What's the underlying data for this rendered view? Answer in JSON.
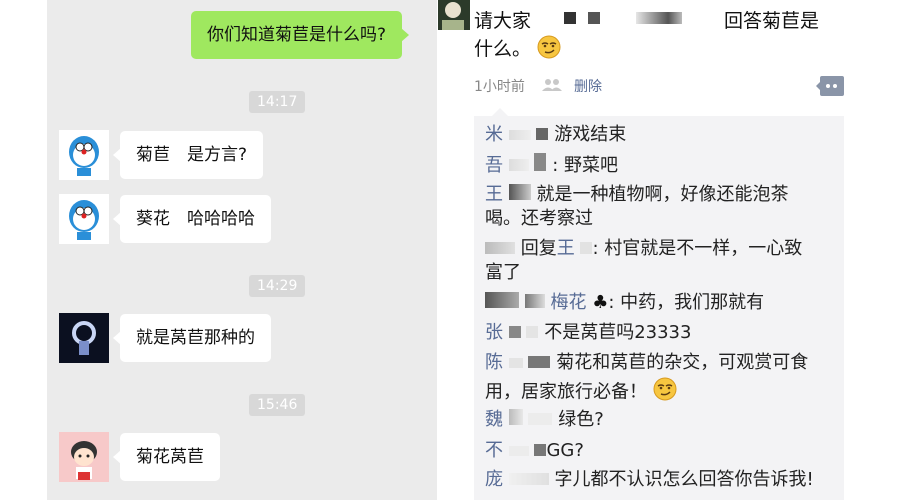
{
  "chat": {
    "messages": [
      {
        "side": "sent",
        "text": "你们知道菊苣是什么吗?"
      },
      {
        "time": "14:17"
      },
      {
        "side": "recv",
        "text": "菊苣　是方言?"
      },
      {
        "side": "recv",
        "text": "葵花　哈哈哈哈"
      },
      {
        "time": "14:29"
      },
      {
        "side": "recv",
        "text": "就是莴苣那种的"
      },
      {
        "time": "15:46"
      },
      {
        "side": "recv",
        "text": "菊花莴苣"
      }
    ]
  },
  "moments": {
    "post": {
      "line1_prefix": "请大家",
      "line1_suffix": "回答菊苣是",
      "line2": "什么。",
      "emoji": "smirk-emoji"
    },
    "meta": {
      "time": "1小时前",
      "delete": "删除"
    },
    "comments": [
      {
        "name": "米",
        "text": "游戏结束"
      },
      {
        "name": "吾",
        "text": ": 野菜吧"
      },
      {
        "name": "王",
        "text": "就是一种植物啊，好像还能泡茶",
        "text2": "喝。还考察过"
      },
      {
        "name_suffix": "回复",
        "name2": "王",
        "text": ": 村官就是不一样，一心致",
        "text2": "富了"
      },
      {
        "name": "梅花",
        "text": ": 中药，我们那就有"
      },
      {
        "name": "张",
        "text": "不是莴苣吗23333"
      },
      {
        "name": "陈",
        "text": "菊花和莴苣的杂交，可观赏可食",
        "text2": "用，居家旅行必备！"
      },
      {
        "name": "魏",
        "text": "绿色?"
      },
      {
        "name": "不",
        "text": "GG?"
      },
      {
        "name": "庞",
        "text": "字儿都不认识怎么回答你告诉我!"
      }
    ]
  },
  "colors": {
    "chat_bg": "#ebebeb",
    "sent_bubble": "#9fe85f",
    "name_blue": "#576b95",
    "comment_bg": "#f3f3f5"
  }
}
